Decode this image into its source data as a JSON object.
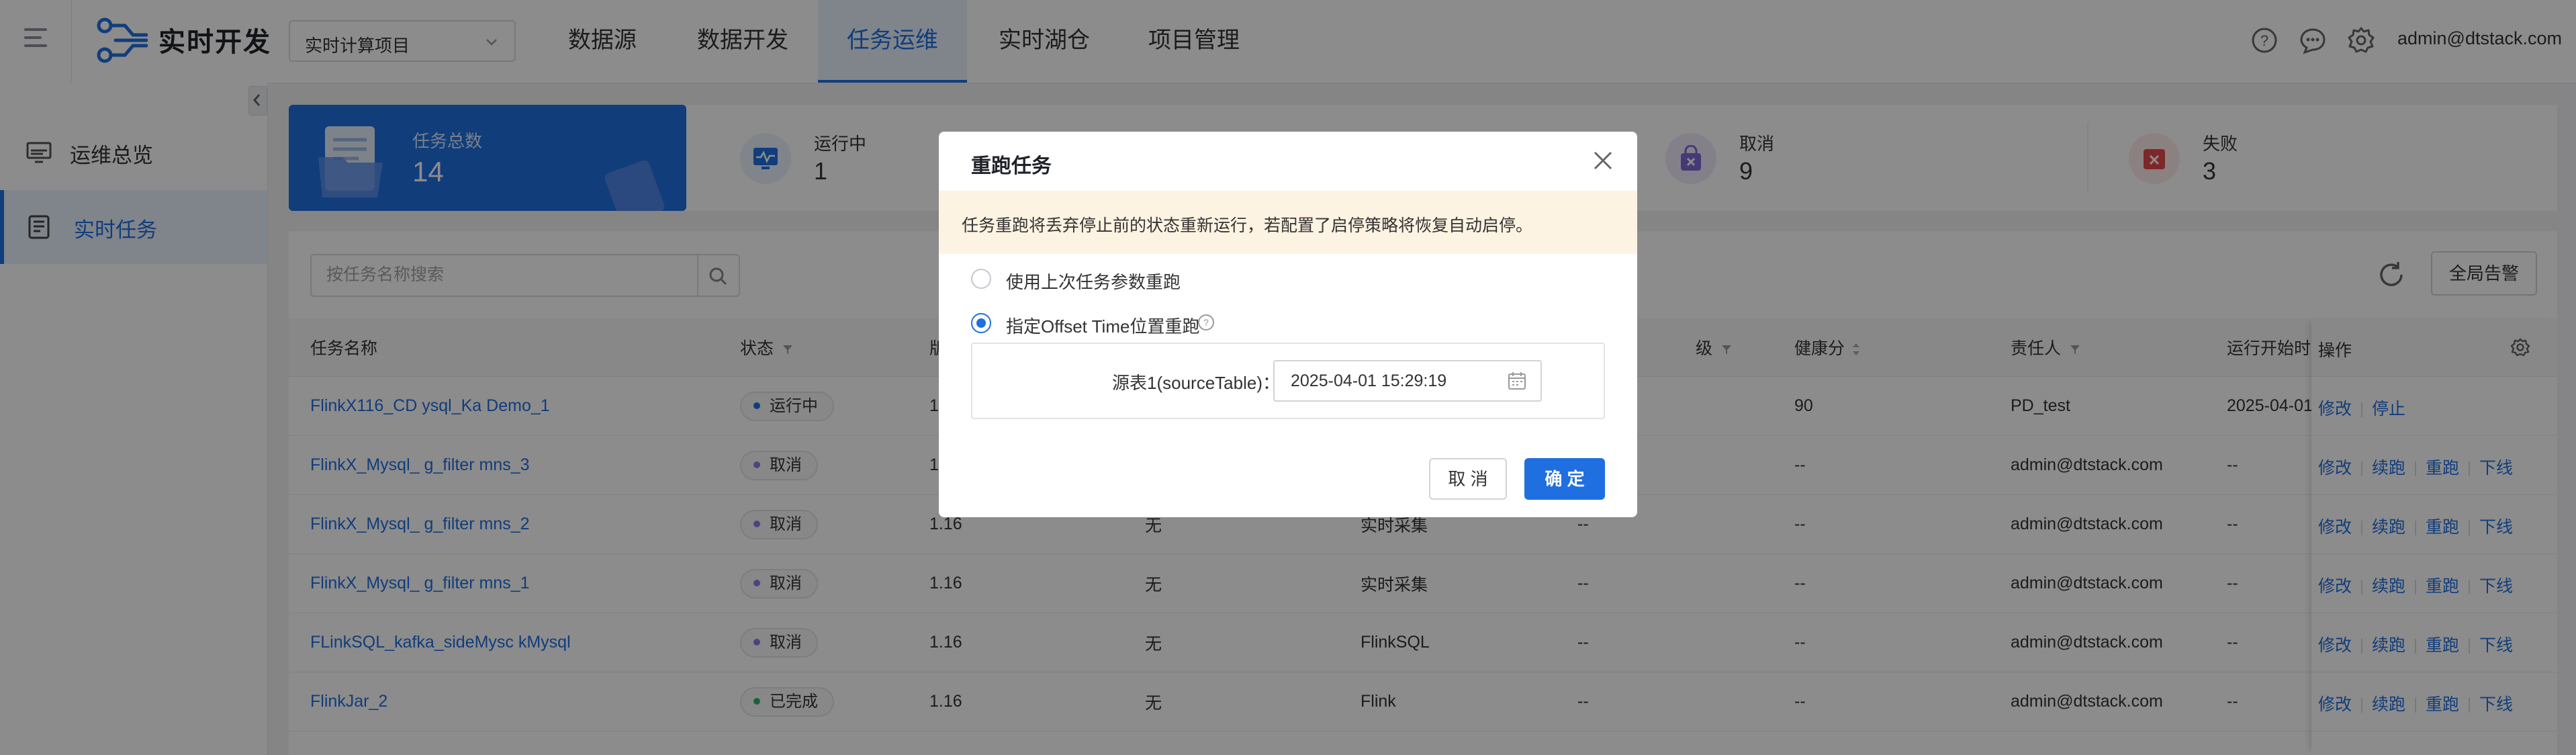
{
  "header": {
    "app_title": "实时开发",
    "project_select": "实时计算项目",
    "nav": [
      "数据源",
      "数据开发",
      "任务运维",
      "实时湖仓",
      "项目管理"
    ],
    "active_nav": "任务运维",
    "user": "admin@dtstack.com"
  },
  "sidebar": {
    "items": [
      {
        "label": "运维总览",
        "icon": "monitor-icon"
      },
      {
        "label": "实时任务",
        "icon": "task-list-icon"
      }
    ],
    "active": "实时任务"
  },
  "stats": {
    "total": {
      "label": "任务总数",
      "value": "14"
    },
    "running": {
      "label": "运行中",
      "value": "1"
    },
    "cancelled": {
      "label": "取消",
      "value": "9"
    },
    "failed": {
      "label": "失败",
      "value": "3"
    }
  },
  "toolbar": {
    "search_placeholder": "按任务名称搜索",
    "global_alarm": "全局告警"
  },
  "table": {
    "columns": {
      "name": "任务名称",
      "status": "状态",
      "partial_version": "版",
      "health": "健康分",
      "owner": "责任人",
      "start_time": "运行开始时间",
      "priority": "级",
      "actions": "操作"
    },
    "rows": [
      {
        "name": "FlinkX116_CD ysql_Ka Demo_1",
        "status": "运行中",
        "status_color": "#1f6fe0",
        "version": "1.",
        "c3": "",
        "type": "",
        "c5": "",
        "health": "90",
        "owner": "PD_test",
        "start": "2025-04-01",
        "actions": [
          "修改",
          "停止"
        ]
      },
      {
        "name": "FlinkX_Mysql_ g_filter mns_3",
        "status": "取消",
        "status_color": "#8c7ae6",
        "version": "1.",
        "c3": "",
        "type": "",
        "c5": "",
        "health": "--",
        "owner": "admin@dtstack.com",
        "start": "--",
        "actions": [
          "修改",
          "续跑",
          "重跑",
          "下线"
        ]
      },
      {
        "name": "FlinkX_Mysql_ g_filter mns_2",
        "status": "取消",
        "status_color": "#8c7ae6",
        "version": "1.16",
        "c3": "无",
        "type": "实时采集",
        "c5": "--",
        "health": "--",
        "owner": "admin@dtstack.com",
        "start": "--",
        "actions": [
          "修改",
          "续跑",
          "重跑",
          "下线"
        ]
      },
      {
        "name": "FlinkX_Mysql_ g_filter mns_1",
        "status": "取消",
        "status_color": "#8c7ae6",
        "version": "1.16",
        "c3": "无",
        "type": "实时采集",
        "c5": "--",
        "health": "--",
        "owner": "admin@dtstack.com",
        "start": "--",
        "actions": [
          "修改",
          "续跑",
          "重跑",
          "下线"
        ]
      },
      {
        "name": "FLinkSQL_kafka_sideMysc kMysql",
        "status": "取消",
        "status_color": "#8c7ae6",
        "version": "1.16",
        "c3": "无",
        "type": "FlinkSQL",
        "c5": "--",
        "health": "--",
        "owner": "admin@dtstack.com",
        "start": "--",
        "actions": [
          "修改",
          "续跑",
          "重跑",
          "下线"
        ]
      },
      {
        "name": "FlinkJar_2",
        "status": "已完成",
        "status_color": "#2fb36c",
        "version": "1.16",
        "c3": "无",
        "type": "Flink",
        "c5": "--",
        "health": "--",
        "owner": "admin@dtstack.com",
        "start": "--",
        "actions": [
          "修改",
          "续跑",
          "重跑",
          "下线"
        ]
      }
    ]
  },
  "modal": {
    "title": "重跑任务",
    "warning": "任务重跑将丢弃停止前的状态重新运行，若配置了启停策略将恢复自动启停。",
    "option_last": "使用上次任务参数重跑",
    "option_offset": "指定Offset Time位置重跑",
    "source_label": "源表1(sourceTable)：",
    "source_time": "2025-04-01 15:29:19",
    "cancel": "取 消",
    "confirm": "确 定"
  },
  "colors": {
    "primary": "#1f6fe0",
    "warning_bg": "#fdf3e2"
  }
}
